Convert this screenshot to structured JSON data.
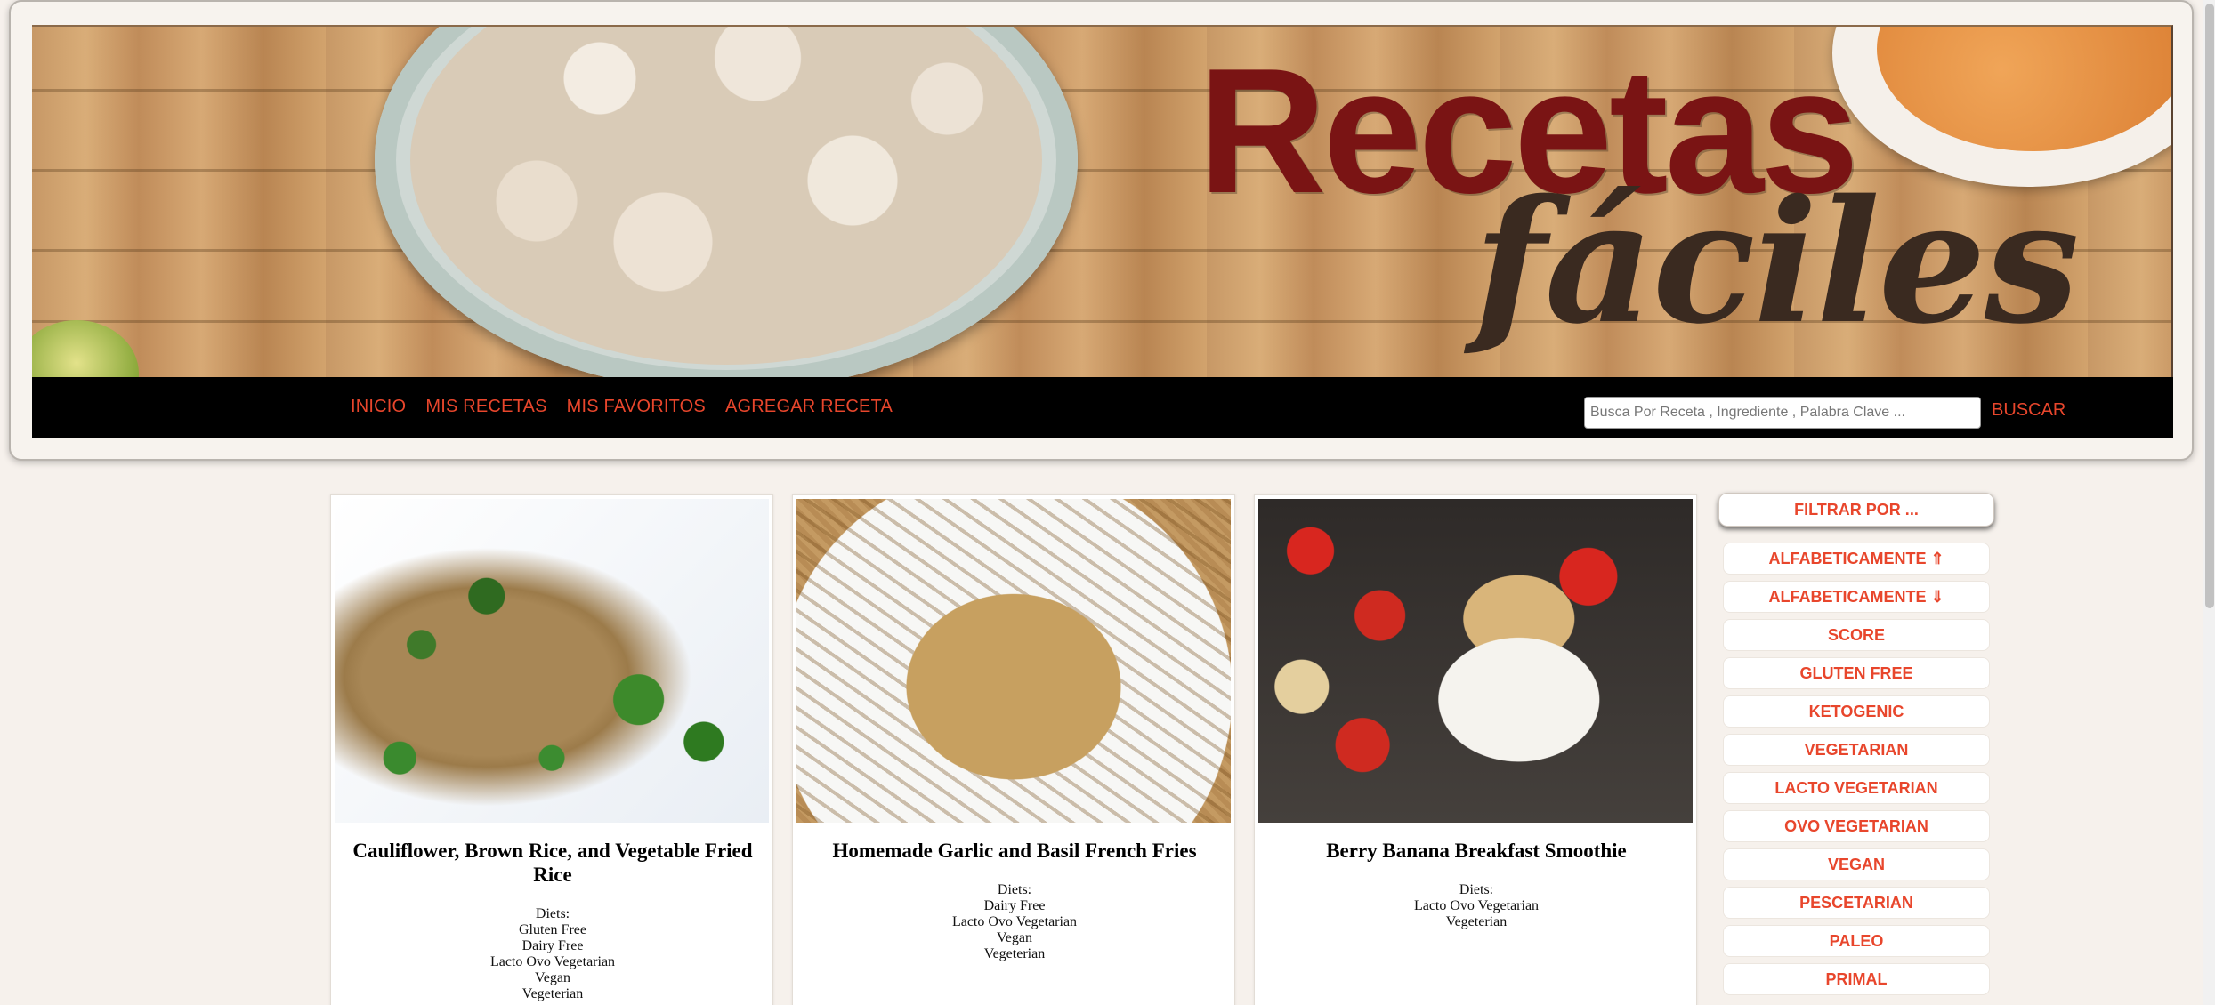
{
  "banner": {
    "title_line1": "Recetas",
    "title_line2": "fáciles"
  },
  "nav": {
    "links": [
      "INICIO",
      "MIS RECETAS",
      "MIS FAVORITOS",
      "AGREGAR RECETA"
    ],
    "search_placeholder": "Busca Por Receta , Ingrediente , Palabra Clave ...",
    "search_button": "BUSCAR"
  },
  "recipes": [
    {
      "title": "Cauliflower, Brown Rice, and Vegetable Fried Rice",
      "diets_label": "Diets:",
      "diets": [
        "Gluten Free",
        "Dairy Free",
        "Lacto Ovo Vegetarian",
        "Vegan",
        "Vegeterian"
      ]
    },
    {
      "title": "Homemade Garlic and Basil French Fries",
      "diets_label": "Diets:",
      "diets": [
        "Dairy Free",
        "Lacto Ovo Vegetarian",
        "Vegan",
        "Vegeterian"
      ]
    },
    {
      "title": "Berry Banana Breakfast Smoothie",
      "diets_label": "Diets:",
      "diets": [
        "Lacto Ovo Vegetarian",
        "Vegeterian"
      ]
    }
  ],
  "filter": {
    "title": "FILTRAR POR ...",
    "options": [
      "ALFABETICAMENTE ⇑",
      "ALFABETICAMENTE ⇓",
      "SCORE",
      "GLUTEN FREE",
      "KETOGENIC",
      "VEGETARIAN",
      "LACTO VEGETARIAN",
      "OVO VEGETARIAN",
      "VEGAN",
      "PESCETARIAN",
      "PALEO",
      "PRIMAL"
    ]
  },
  "colors": {
    "accent": "#e8462c",
    "navbar": "#000000",
    "background": "#f6f1ec"
  }
}
